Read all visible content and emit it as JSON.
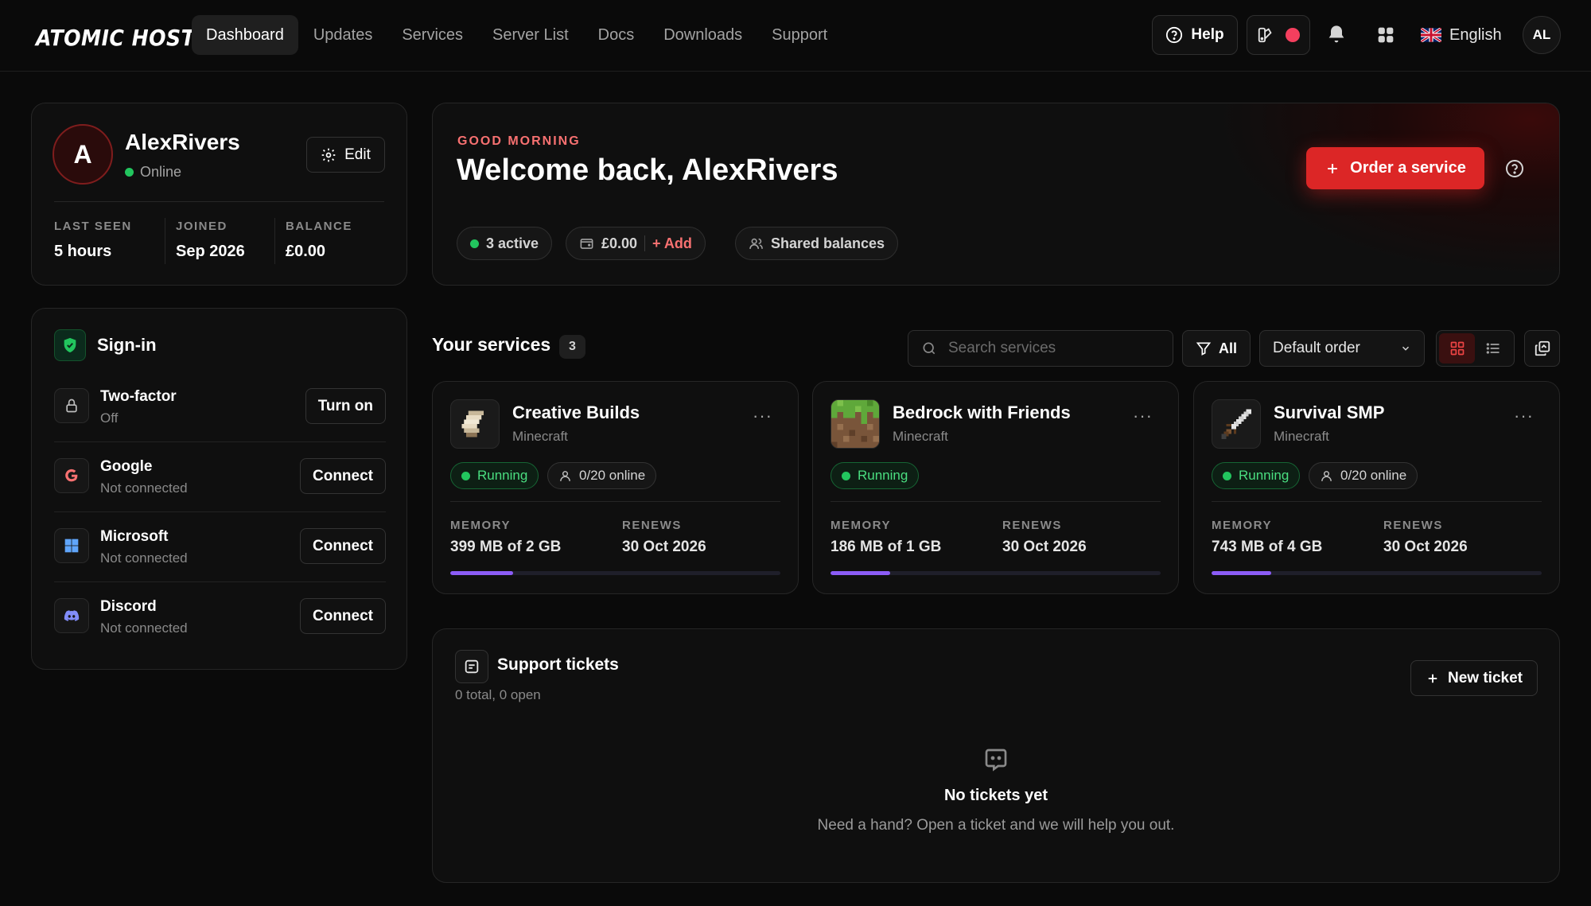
{
  "brand": {
    "logo_text": "ATOMIC HOST"
  },
  "nav": {
    "items": [
      {
        "label": "Dashboard",
        "active": true
      },
      {
        "label": "Updates",
        "active": false
      },
      {
        "label": "Services",
        "active": false
      },
      {
        "label": "Server List",
        "active": false
      },
      {
        "label": "Docs",
        "active": false
      },
      {
        "label": "Downloads",
        "active": false
      },
      {
        "label": "Support",
        "active": false
      }
    ]
  },
  "topbar": {
    "help_label": "Help",
    "language_label": "English",
    "avatar_initials": "AL",
    "status_dot_color": "#f43f5e"
  },
  "profile": {
    "initial": "A",
    "username": "AlexRivers",
    "status": "Online",
    "edit_label": "Edit",
    "stats": [
      {
        "label": "LAST SEEN",
        "value": "5 hours"
      },
      {
        "label": "JOINED",
        "value": "Sep 2026"
      },
      {
        "label": "BALANCE",
        "value": "£0.00"
      }
    ]
  },
  "signin": {
    "title": "Sign-in",
    "rows": [
      {
        "name": "Two-factor",
        "status": "Off",
        "action": "Turn on",
        "icon": "lock-icon"
      },
      {
        "name": "Google",
        "status": "Not connected",
        "action": "Connect",
        "icon": "google-icon"
      },
      {
        "name": "Microsoft",
        "status": "Not connected",
        "action": "Connect",
        "icon": "microsoft-icon"
      },
      {
        "name": "Discord",
        "status": "Not connected",
        "action": "Connect",
        "icon": "discord-icon"
      }
    ]
  },
  "welcome": {
    "greeting": "GOOD MORNING",
    "title": "Welcome back, AlexRivers",
    "order_label": "Order a service",
    "active_chip": "3 active",
    "balance_chip": "£0.00",
    "add_label": "+ Add",
    "shared_chip": "Shared balances",
    "accent_color": "#dc2626"
  },
  "services": {
    "title": "Your services",
    "count": "3",
    "search_placeholder": "Search services",
    "filter_label": "All",
    "order_label": "Default order",
    "items": [
      {
        "name": "Creative Builds",
        "game": "Minecraft",
        "status": "Running",
        "players": "0/20 online",
        "memory_label": "MEMORY",
        "memory": "399 MB of 2 GB",
        "memory_fraction": 0.19,
        "renews_label": "RENEWS",
        "renews": "30 Oct 2026",
        "icon": "scroll-icon"
      },
      {
        "name": "Bedrock with Friends",
        "game": "Minecraft",
        "status": "Running",
        "players": "",
        "memory_label": "MEMORY",
        "memory": "186 MB of 1 GB",
        "memory_fraction": 0.18,
        "renews_label": "RENEWS",
        "renews": "30 Oct 2026",
        "icon": "grass-block-icon"
      },
      {
        "name": "Survival SMP",
        "game": "Minecraft",
        "status": "Running",
        "players": "0/20 online",
        "memory_label": "MEMORY",
        "memory": "743 MB of 4 GB",
        "memory_fraction": 0.18,
        "renews_label": "RENEWS",
        "renews": "30 Oct 2026",
        "icon": "sword-icon"
      }
    ]
  },
  "tickets": {
    "title": "Support tickets",
    "subtitle": "0 total, 0 open",
    "new_label": "New ticket",
    "empty_title": "No tickets yet",
    "empty_sub": "Need a hand? Open a ticket and we will help you out."
  }
}
